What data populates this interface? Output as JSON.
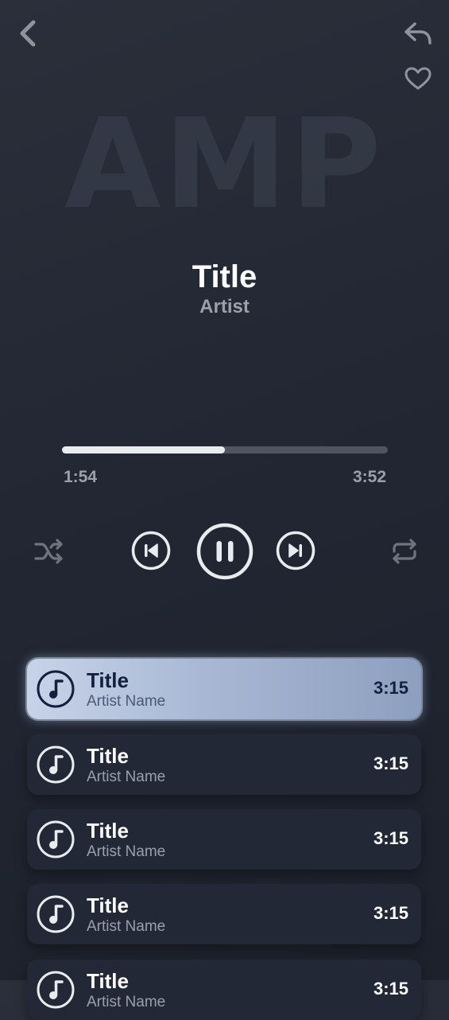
{
  "header": {
    "back_icon": "chevron-left-icon",
    "share_icon": "reply-arrow-icon",
    "favorite_icon": "heart-outline-icon"
  },
  "logo_text": "AMP",
  "now_playing": {
    "title": "Title",
    "artist": "Artist",
    "elapsed": "1:54",
    "total": "3:52",
    "progress": 0.5
  },
  "controls": {
    "shuffle_icon": "shuffle-icon",
    "previous_icon": "skip-previous-icon",
    "pause_icon": "pause-icon",
    "next_icon": "skip-next-icon",
    "repeat_icon": "repeat-icon"
  },
  "playlist": [
    {
      "title": "Title",
      "artist": "Artist Name",
      "duration": "3:15",
      "active": true
    },
    {
      "title": "Title",
      "artist": "Artist Name",
      "duration": "3:15",
      "active": false
    },
    {
      "title": "Title",
      "artist": "Artist Name",
      "duration": "3:15",
      "active": false
    },
    {
      "title": "Title",
      "artist": "Artist Name",
      "duration": "3:15",
      "active": false
    },
    {
      "title": "Title",
      "artist": "Artist Name",
      "duration": "3:15",
      "active": false
    }
  ],
  "colors": {
    "background": "#222733",
    "card": "#232836",
    "active_card": "#b2c1dc",
    "text_primary": "#ffffff",
    "text_muted": "#9ca0a8",
    "progress_fill": "#e9ecef",
    "progress_track": "#4f5460"
  }
}
